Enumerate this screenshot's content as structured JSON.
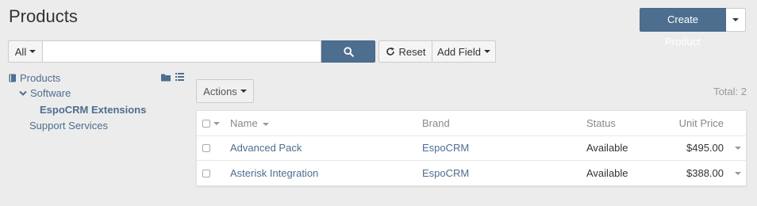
{
  "header": {
    "title": "Products",
    "create_label": "Create Product"
  },
  "search": {
    "filter_label": "All",
    "placeholder": "",
    "value": "",
    "reset_label": "Reset",
    "add_field_label": "Add Field"
  },
  "tree": {
    "root_label": "Products",
    "items": [
      {
        "label": "Software"
      },
      {
        "label": "EspoCRM Extensions"
      },
      {
        "label": "Support Services"
      }
    ]
  },
  "list": {
    "actions_label": "Actions",
    "total_text": "Total: 2",
    "columns": {
      "name": "Name",
      "brand": "Brand",
      "status": "Status",
      "unit_price": "Unit Price"
    },
    "rows": [
      {
        "name": "Advanced Pack",
        "brand": "EspoCRM",
        "status": "Available",
        "unit_price": "$495.00"
      },
      {
        "name": "Asterisk Integration",
        "brand": "EspoCRM",
        "status": "Available",
        "unit_price": "$388.00"
      }
    ]
  },
  "colors": {
    "accent": "#4d6e8f",
    "link": "#4d6e8f",
    "background": "#ececec"
  },
  "icons": {
    "search": "search-icon",
    "reset": "refresh-icon",
    "folder": "folder-icon",
    "list": "list-icon",
    "book": "book-icon",
    "chevron": "chevron-down-icon"
  }
}
